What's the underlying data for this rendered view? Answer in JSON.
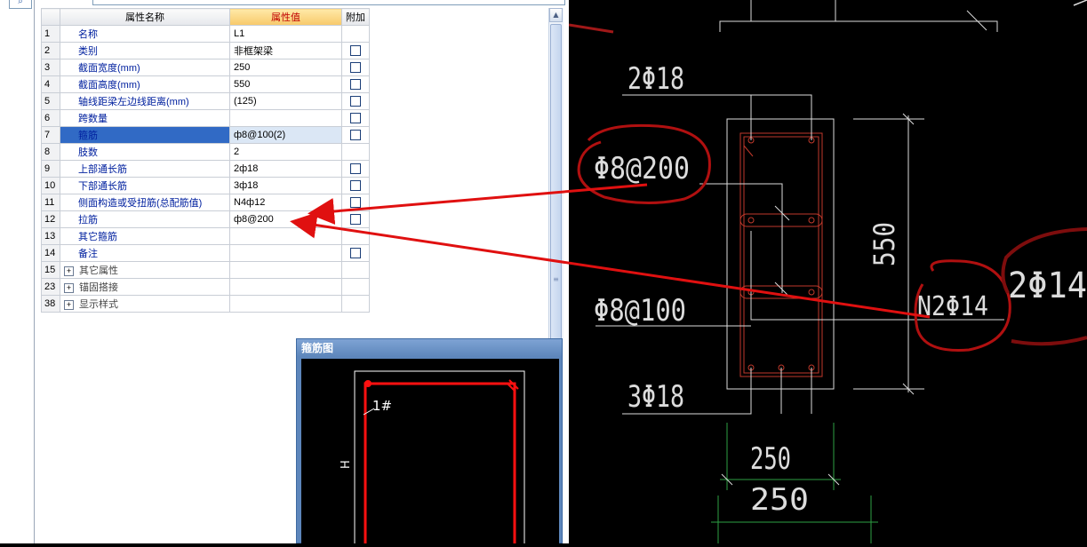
{
  "property_panel": {
    "headers": {
      "name": "属性名称",
      "value": "属性值",
      "add": "附加"
    },
    "rows": [
      {
        "num": "1",
        "name": "名称",
        "value": "L1",
        "checkbox": false,
        "selected": false
      },
      {
        "num": "2",
        "name": "类别",
        "value": "非框架梁",
        "checkbox": true,
        "selected": false
      },
      {
        "num": "3",
        "name": "截面宽度(mm)",
        "value": "250",
        "checkbox": true,
        "selected": false
      },
      {
        "num": "4",
        "name": "截面高度(mm)",
        "value": "550",
        "checkbox": true,
        "selected": false
      },
      {
        "num": "5",
        "name": "轴线距梁左边线距离(mm)",
        "value": "(125)",
        "checkbox": true,
        "selected": false
      },
      {
        "num": "6",
        "name": "跨数量",
        "value": "",
        "checkbox": true,
        "selected": false
      },
      {
        "num": "7",
        "name": "箍筋",
        "value": "ф8@100(2)",
        "checkbox": true,
        "selected": true
      },
      {
        "num": "8",
        "name": "肢数",
        "value": "2",
        "checkbox": false,
        "selected": false
      },
      {
        "num": "9",
        "name": "上部通长筋",
        "value": "2ф18",
        "checkbox": true,
        "selected": false
      },
      {
        "num": "10",
        "name": "下部通长筋",
        "value": "3ф18",
        "checkbox": true,
        "selected": false
      },
      {
        "num": "11",
        "name": "侧面构造或受扭筋(总配筋值)",
        "value": "N4ф12",
        "checkbox": true,
        "selected": false
      },
      {
        "num": "12",
        "name": "拉筋",
        "value": "ф8@200",
        "checkbox": true,
        "selected": false
      },
      {
        "num": "13",
        "name": "其它箍筋",
        "value": "",
        "checkbox": false,
        "selected": false
      },
      {
        "num": "14",
        "name": "备注",
        "value": "",
        "checkbox": true,
        "selected": false
      }
    ],
    "groups": [
      {
        "num": "15",
        "name": "其它属性"
      },
      {
        "num": "23",
        "name": "锚固搭接"
      },
      {
        "num": "38",
        "name": "显示样式"
      }
    ]
  },
  "stirrup_window": {
    "title": "箍筋图",
    "label_1": "1#",
    "label_h": "H"
  },
  "cad_drawing": {
    "top_bars": "2Φ18",
    "tie_annotation": "Φ8@200",
    "stirrup_annotation": "Φ8@100",
    "bottom_bars": "3Φ18",
    "height_dim": "550",
    "width_dim": "250",
    "width_dim_lower": "250",
    "side_bars": "N2Φ14",
    "right_partial": "2Φ14"
  },
  "colors": {
    "annotation_red": "#e01010",
    "cad_line": "#dcdcdc",
    "cad_red": "#c0392b",
    "cad_green": "#2ea043",
    "selected_row": "#316ac5",
    "label_blue": "#00209f"
  }
}
